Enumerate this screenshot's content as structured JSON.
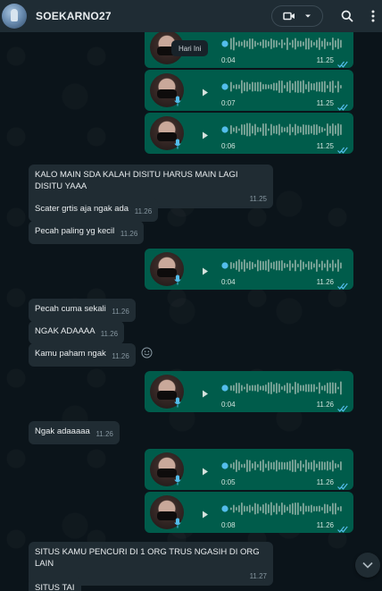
{
  "header": {
    "contact_name": "SOEKARNO27",
    "icons": [
      "avatar",
      "video-call-icon",
      "chevron-down-icon",
      "search-icon",
      "more-vertical-icon"
    ]
  },
  "date_chip": "Hari Ini",
  "voice_notes": [
    {
      "duration": "0:04",
      "time": "11.25"
    },
    {
      "duration": "0:07",
      "time": "11.25"
    },
    {
      "duration": "0:06",
      "time": "11.25"
    },
    {
      "duration": "0:04",
      "time": "11.26"
    },
    {
      "duration": "0:04",
      "time": "11.26"
    },
    {
      "duration": "0:05",
      "time": "11.26"
    },
    {
      "duration": "0:08",
      "time": "11.26"
    }
  ],
  "messages": [
    {
      "text": "KALO MAIN SDA KALAH DISITU HARUS MAIN LAGI DISITU YAAA",
      "time": "11.25"
    },
    {
      "text": "Scater grtis aja ngak ada",
      "time": "11.26"
    },
    {
      "text": "Pecah paling yg kecil",
      "time": "11.26"
    },
    {
      "text": "Pecah cuma sekali",
      "time": "11.26"
    },
    {
      "text": "NGAK ADAAAA",
      "time": "11.26"
    },
    {
      "text": "Kamu paham ngak",
      "time": "11.26"
    },
    {
      "text": "Ngak adaaaaa",
      "time": "11.26"
    },
    {
      "text": "SITUS KAMU PENCURI DI 1 ORG TRUS NGASIH DI ORG LAIN",
      "time": "11.27"
    },
    {
      "text": "SITUS TAI",
      "time": ""
    }
  ],
  "colors": {
    "header_bg": "#1f2c34",
    "chat_bg": "#0b141a",
    "incoming_bubble": "#202c33",
    "outgoing_bubble": "#005c4b",
    "read_ticks": "#53bdeb"
  }
}
